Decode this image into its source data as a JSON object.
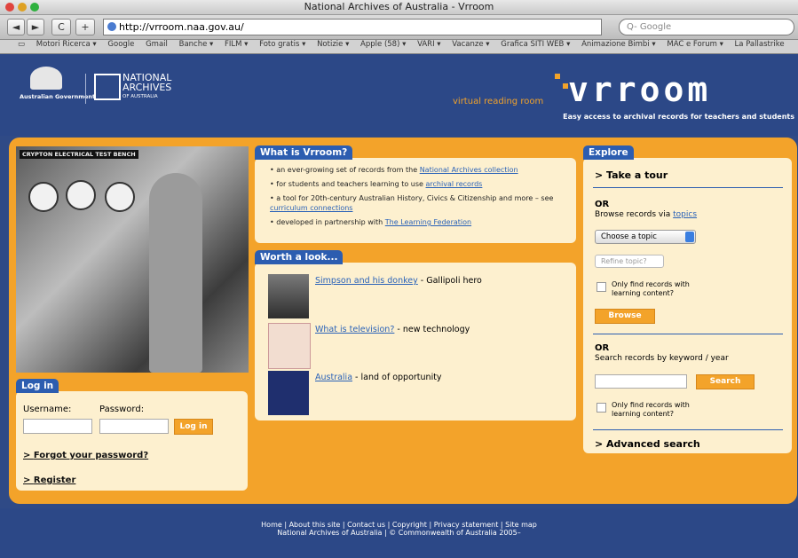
{
  "window": {
    "title": "National Archives of Australia - Vrroom"
  },
  "toolbar": {
    "url": "http://vrroom.naa.gov.au/",
    "search_placeholder": "Q- Google",
    "back": "◄",
    "forward": "►",
    "reload": "C",
    "add": "+"
  },
  "bookmarks": [
    "Motori Ricerca ▾",
    "Google",
    "Gmail",
    "Banche ▾",
    "FILM ▾",
    "Foto gratis ▾",
    "Notizie ▾",
    "Apple (58) ▾",
    "VARI ▾",
    "Vacanze ▾",
    "Grafica SITI WEB ▾",
    "Animazione Bimbi ▾",
    "MAC e Forum ▾",
    "La Pallastrike"
  ],
  "header": {
    "gov_label": "Australian Government",
    "naa_line1": "NATIONAL",
    "naa_line2": "ARCHIVES",
    "naa_line3": "OF AUSTRALIA",
    "vrr_sub": "virtual reading room",
    "vrr_logo": "vrroom",
    "tagline": "Easy access to archival records for teachers and students"
  },
  "photo": {
    "caption": "CRYPTON ELECTRICAL TEST BENCH"
  },
  "login": {
    "tab": "Log in",
    "username_label": "Username:",
    "password_label": "Password:",
    "button": "Log in",
    "forgot": "Forgot your password?",
    "register": "Register"
  },
  "what": {
    "tab": "What is Vrroom?",
    "items": [
      {
        "pre": "an ever-growing set of records from the ",
        "link": "National Archives collection",
        "post": ""
      },
      {
        "pre": "for students and teachers learning to use ",
        "link": "archival records",
        "post": ""
      },
      {
        "pre": "a tool for 20th-century Australian History, Civics & Citizenship and more – see ",
        "link": "curriculum connections",
        "post": ""
      },
      {
        "pre": "developed in partnership with ",
        "link": "The Learning Federation",
        "post": ""
      }
    ]
  },
  "worth": {
    "tab": "Worth a look...",
    "items": [
      {
        "link": "Simpson and his donkey",
        "desc": " - Gallipoli hero"
      },
      {
        "link": "What is television?",
        "desc": " - new technology"
      },
      {
        "link": "Australia",
        "desc": " - land of opportunity"
      }
    ]
  },
  "explore": {
    "tab": "Explore",
    "tour": "Take a tour",
    "or1": "OR",
    "browse_pre": "Browse records via ",
    "browse_link": "topics",
    "topic_select": "Choose a topic",
    "refine_select": "Refine topic?",
    "only_find1": "Only find records with learning content?",
    "browse_btn": "Browse",
    "or2": "OR",
    "search_label": "Search records by keyword / year",
    "search_btn": "Search",
    "only_find2": "Only find records with learning content?",
    "advanced": "Advanced search"
  },
  "footer": {
    "line1": "Home | About this site | Contact us | Copyright | Privacy statement | Site map",
    "line2": "National Archives of Australia | © Commonwealth of Australia 2005–"
  }
}
